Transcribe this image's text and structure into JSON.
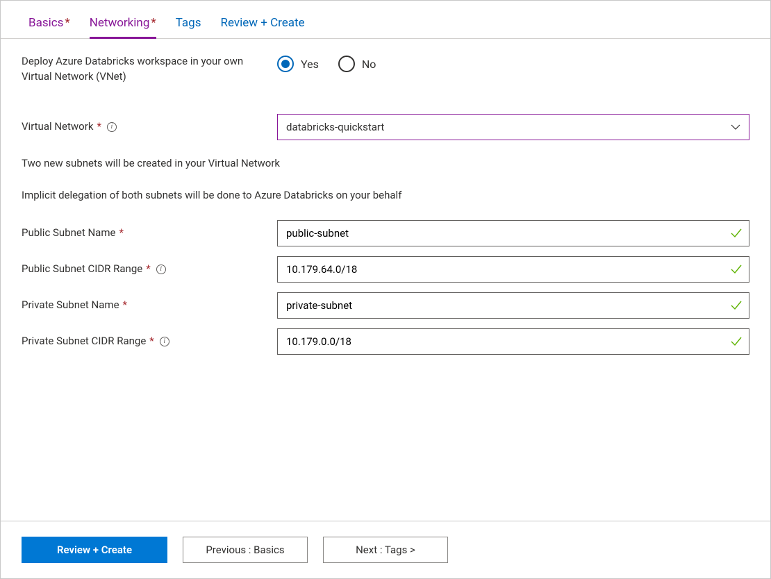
{
  "tabs": {
    "basics": "Basics",
    "networking": "Networking",
    "tags": "Tags",
    "review": "Review + Create"
  },
  "fields": {
    "deploy_vnet": {
      "label": "Deploy Azure Databricks workspace in your own Virtual Network (VNet)",
      "yes": "Yes",
      "no": "No"
    },
    "virtual_network": {
      "label": "Virtual Network",
      "value": "databricks-quickstart"
    },
    "info_line1": "Two new subnets will be created in your Virtual Network",
    "info_line2": "Implicit delegation of both subnets will be done to Azure Databricks on your behalf",
    "public_subnet_name": {
      "label": "Public Subnet Name",
      "value": "public-subnet"
    },
    "public_subnet_cidr": {
      "label": "Public Subnet CIDR Range",
      "value": "10.179.64.0/18"
    },
    "private_subnet_name": {
      "label": "Private Subnet Name",
      "value": "private-subnet"
    },
    "private_subnet_cidr": {
      "label": "Private Subnet CIDR Range",
      "value": "10.179.0.0/18"
    }
  },
  "footer": {
    "review_create": "Review + Create",
    "previous": "Previous : Basics",
    "next": "Next : Tags >"
  }
}
